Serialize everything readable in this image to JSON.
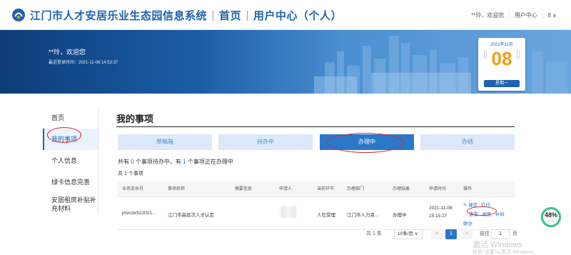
{
  "header": {
    "site_title": "江门市人才安居乐业生态园信息系统",
    "nav_home": "首页",
    "nav_user_center": "用户中心（个人）",
    "greeting": "**玲，欢迎您",
    "user_center_link": "用户中心",
    "user_icon_label": "8 ∨"
  },
  "banner": {
    "welcome": "**玲，欢迎您",
    "last_login": "最近登录时间：2021-11-08 14:52:37",
    "calendar": {
      "month": "2021年11月",
      "day": "08",
      "weekday": "星期一"
    }
  },
  "sidebar": {
    "items": [
      {
        "label": "首页",
        "active": false
      },
      {
        "label": "我的事项",
        "active": true
      },
      {
        "label": "个人信息",
        "active": false
      },
      {
        "label": "绿卡信息完善",
        "active": false
      },
      {
        "label": "安居租房补贴补充材料",
        "active": false
      }
    ]
  },
  "main": {
    "title": "我的事项",
    "tabs": [
      {
        "label": "草稿箱",
        "active": false
      },
      {
        "label": "待办中",
        "active": false
      },
      {
        "label": "办理中",
        "active": true
      },
      {
        "label": "办结",
        "active": false
      }
    ],
    "summary": {
      "prefix": "共有",
      "pending_count": "0",
      "middle": "个事项待办中，有",
      "processing_count": "1",
      "suffix": "个事项正在办理中"
    },
    "total_items": "共 1 个事项"
  },
  "table": {
    "headers": [
      "业务流水号",
      "事项名称",
      "摘要信息",
      "申请人",
      "当前环节",
      "办理部门",
      "办理结果",
      "申请时间",
      "操作"
    ],
    "rows": [
      {
        "serial": "jmzcdx522021...",
        "item_name": "江门市高层次人才认定",
        "summary": "",
        "applicant": "",
        "current_step": "人社受理",
        "department": "江门市人力资...",
        "result": "办理中",
        "apply_date": "2021-11-08",
        "apply_time": "15:15:27",
        "ops": {
          "urge": "✎ 催促",
          "print": "打印",
          "view": "查看",
          "progress": "进度",
          "supplement": "补料",
          "handle": "联办"
        }
      }
    ]
  },
  "pagination": {
    "total": "共 1 条",
    "page_size": "10条/页",
    "prev": "<",
    "current": "1",
    "next": ">",
    "goto_label": "前往",
    "goto_value": "1",
    "goto_unit": "页"
  },
  "widget": {
    "percent": "48%",
    "temp": "47°C"
  },
  "watermark": {
    "line1": "激活 Windows",
    "line2": "转到\"设置\"以激活 Windows。"
  }
}
